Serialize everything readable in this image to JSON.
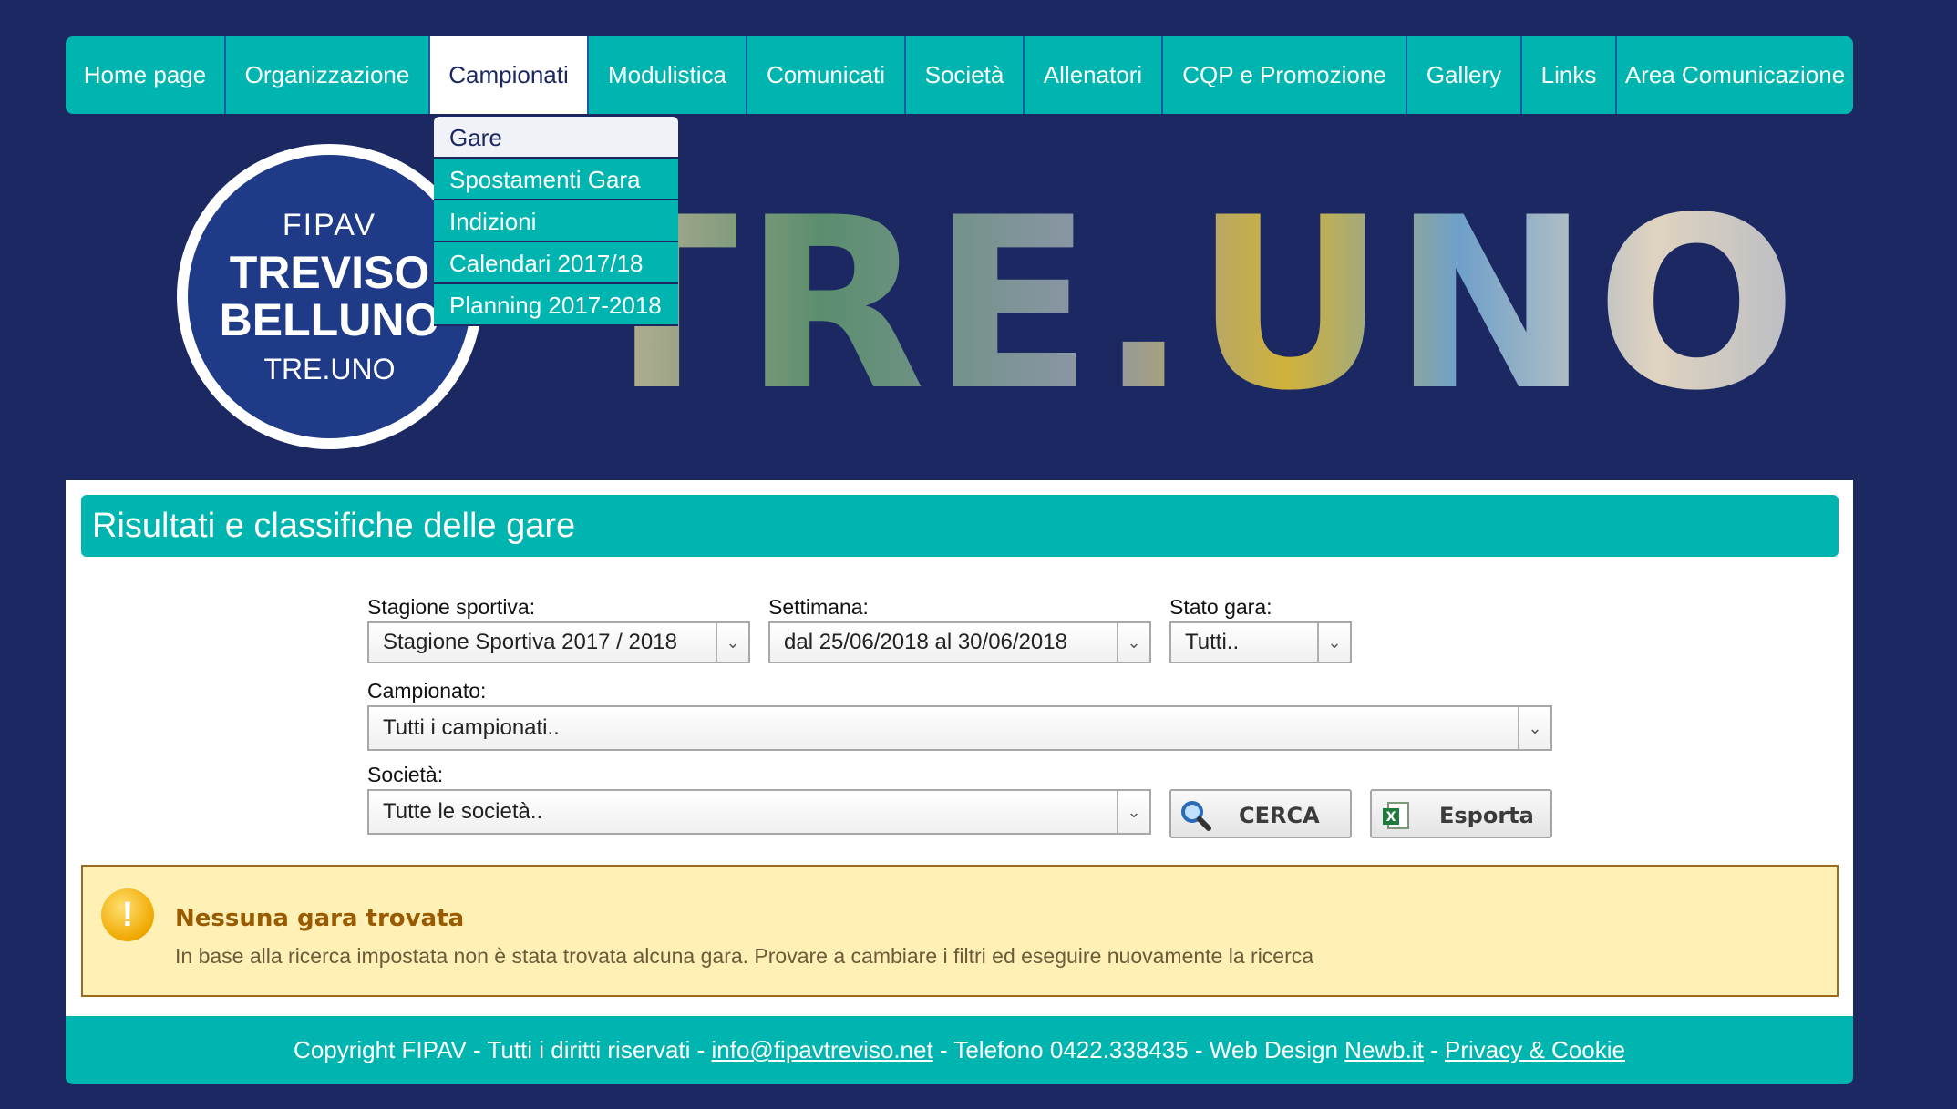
{
  "nav": {
    "items": [
      {
        "label": "Home page",
        "w": 176
      },
      {
        "label": "Organizzazione",
        "w": 224
      },
      {
        "label": "Campionati",
        "w": 174,
        "active": true
      },
      {
        "label": "Modulistica",
        "w": 174
      },
      {
        "label": "Comunicati",
        "w": 174
      },
      {
        "label": "Società",
        "w": 130
      },
      {
        "label": "Allenatori",
        "w": 152
      },
      {
        "label": "CQP e Promozione",
        "w": 268
      },
      {
        "label": "Gallery",
        "w": 126
      },
      {
        "label": "Links",
        "w": 104
      },
      {
        "label": "Area Comunicazione",
        "w": 259
      }
    ],
    "dropdown": [
      "Gare",
      "Spostamenti Gara",
      "Indizioni",
      "Calendari 2017/18",
      "Planning 2017-2018"
    ]
  },
  "banner": {
    "logo_line1": "FIPAV",
    "logo_line2": "TREVISO",
    "logo_line3": "BELLUNO",
    "logo_line4": "TRE.UNO",
    "big_title": "TRE.UNO"
  },
  "main": {
    "title": "Risultati e classifiche delle gare",
    "season_label": "Stagione sportiva:",
    "season_value": "Stagione Sportiva 2017 / 2018",
    "week_label": "Settimana:",
    "week_value": "dal 25/06/2018 al 30/06/2018",
    "status_label": "Stato gara:",
    "status_value": "Tutti..",
    "championship_label": "Campionato:",
    "championship_value": "Tutti i campionati..",
    "society_label": "Società:",
    "society_value": "Tutte le società..",
    "search_button": "CERCA",
    "export_button": "Esporta"
  },
  "alert": {
    "title": "Nessuna gara trovata",
    "text": "In base alla ricerca impostata non è stata trovata alcuna gara. Provare a cambiare i filtri ed eseguire nuovamente la ricerca"
  },
  "footer": {
    "text1": "Copyright FIPAV - Tutti i diritti riservati - ",
    "email": "info@fipavtreviso.net",
    "text2": " - Telefono 0422.338435 - Web Design ",
    "webdesign": "Newb.it",
    "text3": " - ",
    "privacy": "Privacy & Cookie"
  },
  "colors": {
    "background": "#1b2862",
    "accent": "#00b5b0",
    "alert_bg": "#fff0b5"
  }
}
